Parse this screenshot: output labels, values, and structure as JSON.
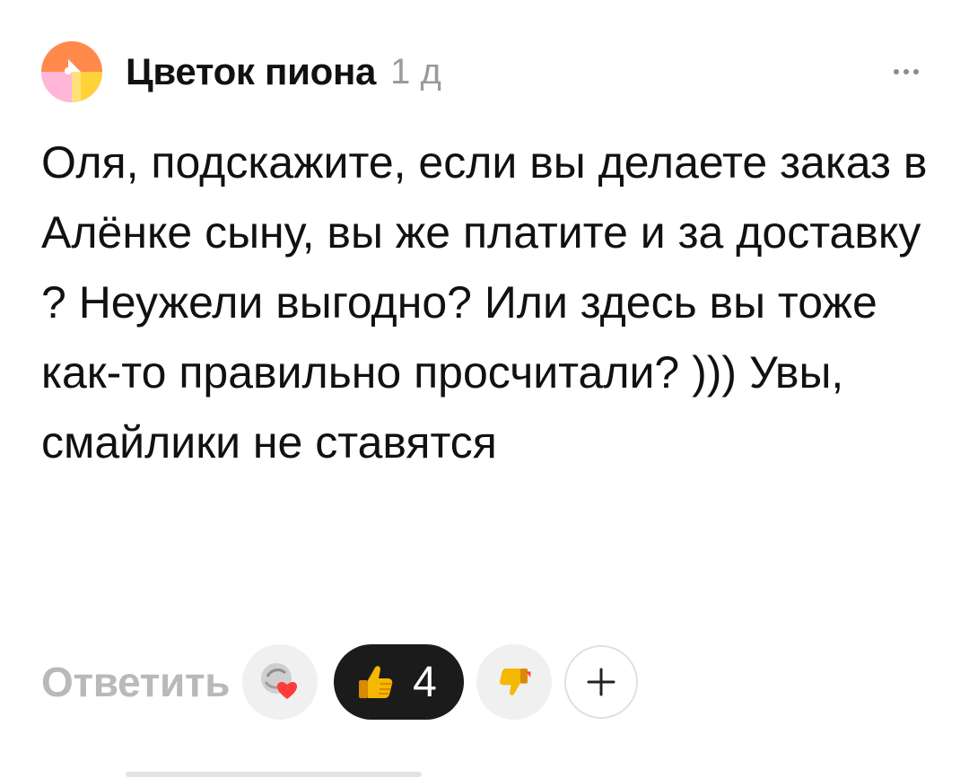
{
  "comment": {
    "author": "Цветок пиона",
    "time": "1 д",
    "text": "Оля, подскажите, если вы делаете заказ в Алёнке сыну, вы же платите и за доставку ? Неужели выгодно? Или здесь вы тоже как-то правильно просчитали? ))) Увы, смайлики не ставятся"
  },
  "actions": {
    "reply_label": "Ответить",
    "likes_count": "4"
  },
  "icons": {
    "avatar": "flower-avatar-icon",
    "more": "more-dots-icon",
    "sticker": "heart-sticker-icon",
    "like": "thumbs-up-icon",
    "dislike": "thumbs-down-icon",
    "add": "plus-icon"
  },
  "colors": {
    "avatar_orange": "#ff8a4c",
    "avatar_pink": "#ffb6d9",
    "avatar_yellow": "#ffd23a",
    "reply_gray": "#b9b9b9",
    "likes_bg": "#1b1b1b",
    "thumb_yellow": "#f5b800",
    "heart_red": "#ff3b3b"
  }
}
